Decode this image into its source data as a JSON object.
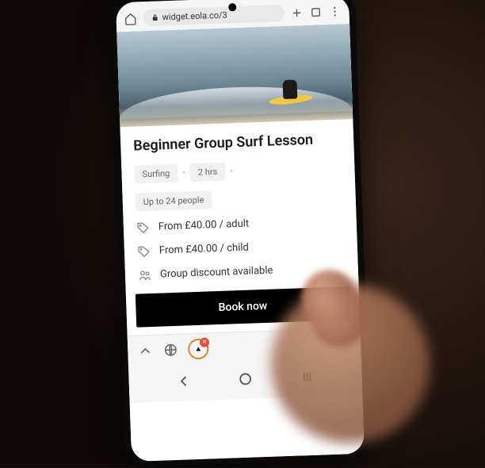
{
  "browser": {
    "url": "widget.eola.co/3"
  },
  "hero": {
    "alt": "Surfer on yellow board riding a wave"
  },
  "title": "Beginner Group Surf Lesson",
  "chips": {
    "activity": "Surfing",
    "duration": "2 hrs",
    "capacity": "Up to 24 people"
  },
  "pricing": {
    "adult": "From £40.00 / adult",
    "child": "From £40.00 / child"
  },
  "discount": "Group discount available",
  "cta": "Book now"
}
